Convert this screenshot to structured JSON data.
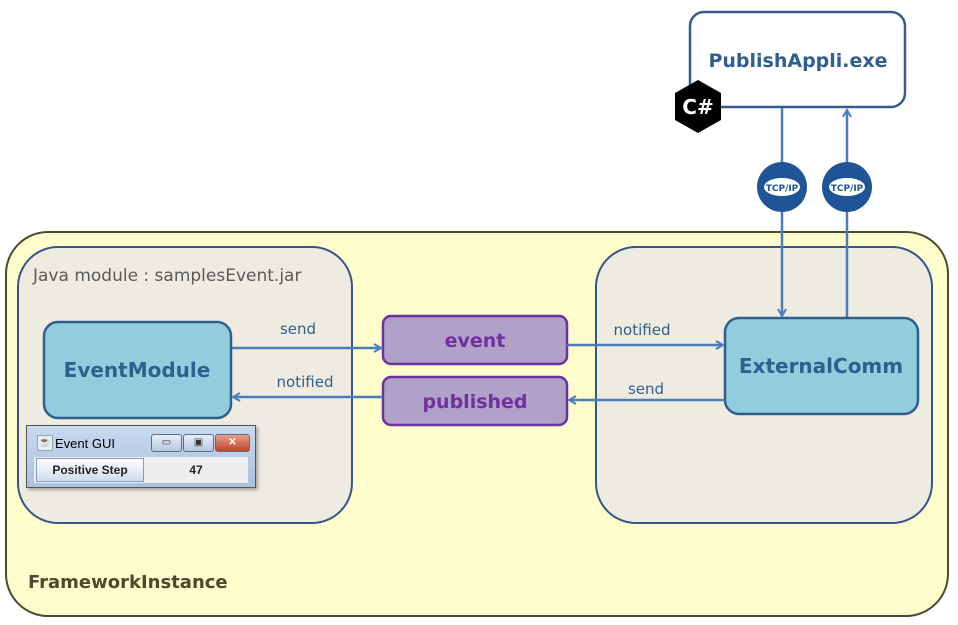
{
  "framework": {
    "label": "FrameworkInstance"
  },
  "java_module": {
    "label": "Java module : samplesEvent.jar"
  },
  "nodes": {
    "event_module": "EventModule",
    "external_comm": "ExternalComm",
    "event": "event",
    "published": "published",
    "publish_appli": "PublishAppli.exe"
  },
  "edges": {
    "send_left": "send",
    "notified_left": "notified",
    "notified_right": "notified",
    "send_right": "send"
  },
  "badges": {
    "csharp": "C#",
    "tcp1": "TCP/IP",
    "tcp2": "TCP/IP"
  },
  "gui": {
    "title": "Event GUI",
    "button": "Positive Step",
    "value": "47",
    "minimize": "▭",
    "maximize": "▣",
    "close": "✕"
  },
  "colors": {
    "framework_fill": "#fefdcb",
    "module_fill": "#eeebe0",
    "node_fill": "#92cddd",
    "topic_fill": "#b1a0c7",
    "topic_text": "#7030a0",
    "line": "#4a7ebb",
    "node_text": "#2f5f8c"
  }
}
